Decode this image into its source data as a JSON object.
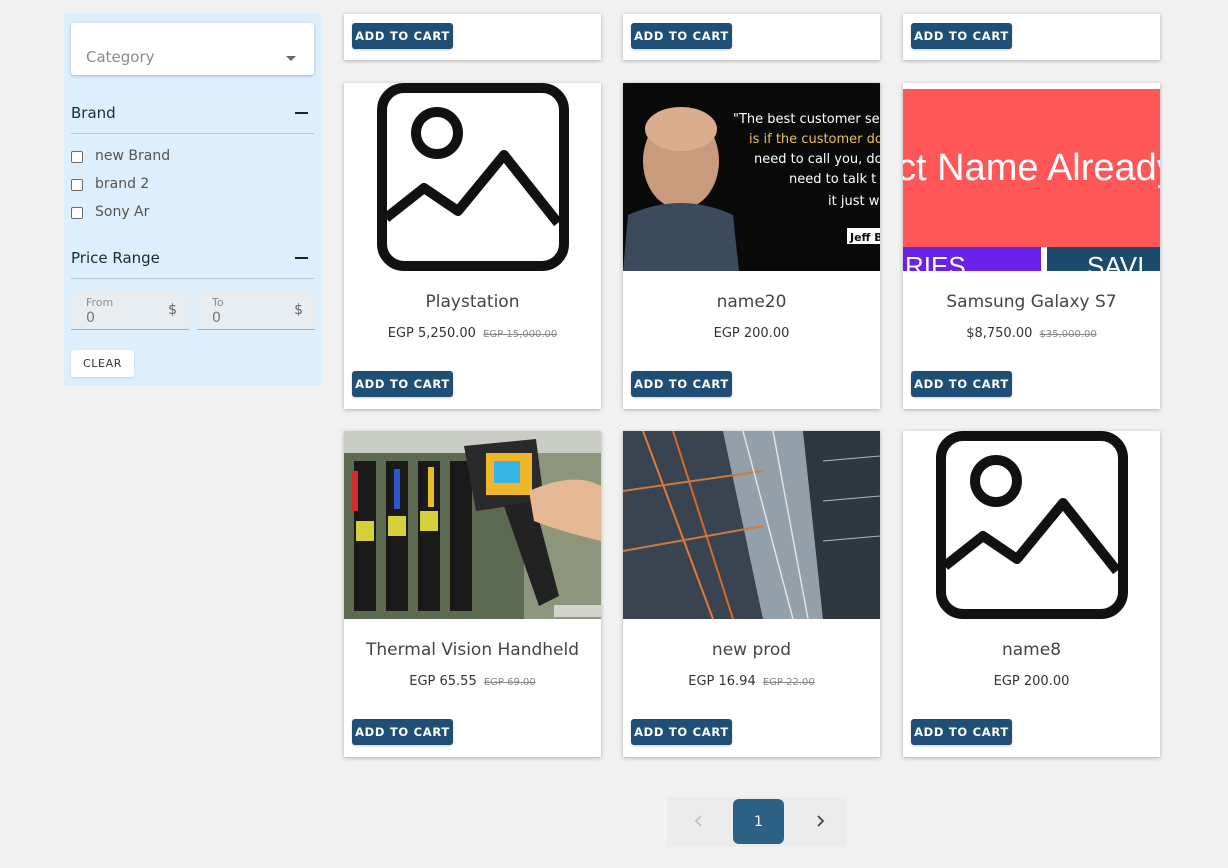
{
  "filters": {
    "category_placeholder": "Category",
    "brand": {
      "title": "Brand",
      "options": [
        "new Brand",
        "brand 2",
        "Sony Ar"
      ]
    },
    "price": {
      "title": "Price Range",
      "from_label": "From",
      "from_value": "0",
      "to_label": "To",
      "to_value": "0",
      "currency": "$"
    },
    "clear_label": "CLEAR"
  },
  "cart_label": "ADD TO CART",
  "products": [
    {
      "name": "Playstation",
      "price": "EGP 5,250.00",
      "old_price": "EGP 15,000.00",
      "image": "image-placeholder-icon"
    },
    {
      "name": "name20",
      "price": "EGP 200.00",
      "old_price": "",
      "image": "jeff-quote-photo",
      "image_text": [
        "\"The best customer se",
        "is if the customer do",
        "need to call you, do",
        "need to talk t",
        "it just wo",
        "Jeff B"
      ]
    },
    {
      "name": "Samsung Galaxy S7",
      "price": "$8,750.00",
      "old_price": "$35,000.00",
      "image": "banner-photo",
      "image_text": [
        "ct Name Already",
        "RIES",
        "SAVI"
      ]
    },
    {
      "name": "Thermal Vision Handheld",
      "price": "EGP 65.55",
      "old_price": "EGP 69.00",
      "image": "thermal-camera-photo"
    },
    {
      "name": "new prod",
      "price": "EGP 16.94",
      "old_price": "EGP 22.00",
      "image": "building-photo"
    },
    {
      "name": "name8",
      "price": "EGP 200.00",
      "old_price": "",
      "image": "image-placeholder-icon"
    }
  ],
  "pagination": {
    "current_page": "1",
    "prev_icon": "chevron-left-icon",
    "next_icon": "chevron-right-icon"
  },
  "colors": {
    "sidebar_bg": "#ddeefc",
    "button_bg": "#1f4f77",
    "page_active": "#2c6185",
    "page_bg": "#f1f1f1"
  }
}
